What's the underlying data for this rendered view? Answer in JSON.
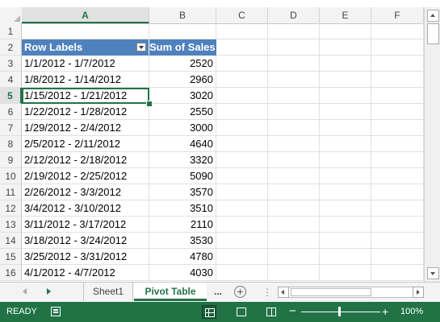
{
  "columns": [
    "A",
    "B",
    "C",
    "D",
    "E",
    "F"
  ],
  "selected_column": "A",
  "selected_row": "5",
  "pivot": {
    "header_labels": "Row Labels",
    "header_values": "Sum of Sales"
  },
  "rows": [
    {
      "num": "1",
      "label": "",
      "value": ""
    },
    {
      "num": "2",
      "label": "Row Labels",
      "value": "Sum of Sales"
    },
    {
      "num": "3",
      "label": "1/1/2012 - 1/7/2012",
      "value": "2520"
    },
    {
      "num": "4",
      "label": "1/8/2012 - 1/14/2012",
      "value": "2960"
    },
    {
      "num": "5",
      "label": "1/15/2012 - 1/21/2012",
      "value": "3020"
    },
    {
      "num": "6",
      "label": "1/22/2012 - 1/28/2012",
      "value": "2550"
    },
    {
      "num": "7",
      "label": "1/29/2012 - 2/4/2012",
      "value": "3000"
    },
    {
      "num": "8",
      "label": "2/5/2012 - 2/11/2012",
      "value": "4640"
    },
    {
      "num": "9",
      "label": "2/12/2012 - 2/18/2012",
      "value": "3320"
    },
    {
      "num": "10",
      "label": "2/19/2012 - 2/25/2012",
      "value": "5090"
    },
    {
      "num": "11",
      "label": "2/26/2012 - 3/3/2012",
      "value": "3570"
    },
    {
      "num": "12",
      "label": "3/4/2012 - 3/10/2012",
      "value": "3510"
    },
    {
      "num": "13",
      "label": "3/11/2012 - 3/17/2012",
      "value": "2110"
    },
    {
      "num": "14",
      "label": "3/18/2012 - 3/24/2012",
      "value": "3530"
    },
    {
      "num": "15",
      "label": "3/25/2012 - 3/31/2012",
      "value": "4780"
    },
    {
      "num": "16",
      "label": "4/1/2012 - 4/7/2012",
      "value": "4030"
    }
  ],
  "tabs": {
    "sheet1": "Sheet1",
    "pivot_table": "Pivot Table",
    "more": "...",
    "add_icon": "plus-circle-icon"
  },
  "status": {
    "mode": "READY",
    "zoom": "100%",
    "zoom_minus": "−",
    "zoom_plus": "+",
    "zoom_fraction": 0.47
  },
  "colors": {
    "accent": "#217346",
    "pivot_header": "#4f81bd"
  }
}
